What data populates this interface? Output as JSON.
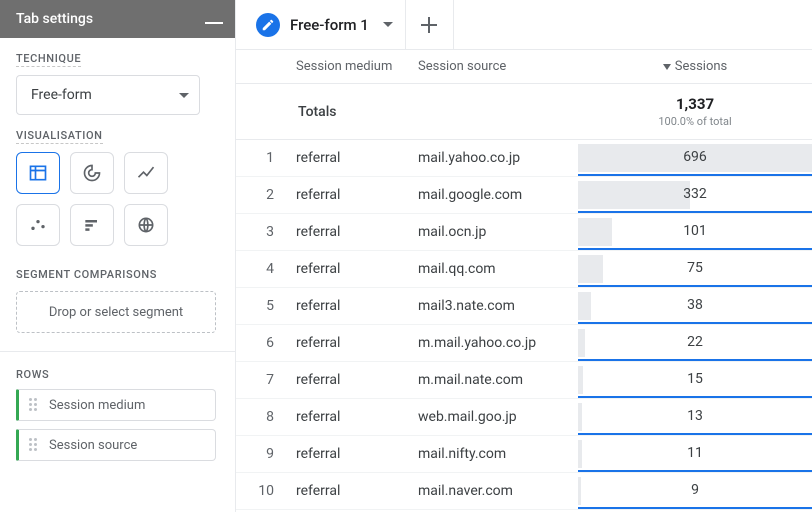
{
  "sidebar": {
    "title": "Tab settings",
    "technique_label": "TECHNIQUE",
    "technique_value": "Free-form",
    "visualisation_label": "VISUALISATION",
    "segment_label": "SEGMENT COMPARISONS",
    "segment_placeholder": "Drop or select segment",
    "rows_label": "ROWS",
    "row_chips": [
      "Session medium",
      "Session source"
    ]
  },
  "tabbar": {
    "tab_title": "Free-form 1"
  },
  "columns": {
    "medium": "Session medium",
    "source": "Session source",
    "sessions": "Sessions"
  },
  "totals": {
    "label": "Totals",
    "value": "1,337",
    "sub": "100.0% of total"
  },
  "chart_data": {
    "type": "bar",
    "title": "Sessions by Session medium / Session source",
    "xlabel": "Session source",
    "ylabel": "Sessions",
    "ylim": [
      0,
      1337
    ],
    "categories": [
      "mail.yahoo.co.jp",
      "mail.google.com",
      "mail.ocn.jp",
      "mail.qq.com",
      "mail3.nate.com",
      "m.mail.yahoo.co.jp",
      "m.mail.nate.com",
      "web.mail.goo.jp",
      "mail.nifty.com",
      "mail.naver.com"
    ],
    "series": [
      {
        "name": "Sessions",
        "values": [
          696,
          332,
          101,
          75,
          38,
          22,
          15,
          13,
          11,
          9
        ]
      }
    ],
    "rows": [
      {
        "idx": "1",
        "medium": "referral",
        "source": "mail.yahoo.co.jp",
        "sessions": 696,
        "label": "696"
      },
      {
        "idx": "2",
        "medium": "referral",
        "source": "mail.google.com",
        "sessions": 332,
        "label": "332"
      },
      {
        "idx": "3",
        "medium": "referral",
        "source": "mail.ocn.jp",
        "sessions": 101,
        "label": "101"
      },
      {
        "idx": "4",
        "medium": "referral",
        "source": "mail.qq.com",
        "sessions": 75,
        "label": "75"
      },
      {
        "idx": "5",
        "medium": "referral",
        "source": "mail3.nate.com",
        "sessions": 38,
        "label": "38"
      },
      {
        "idx": "6",
        "medium": "referral",
        "source": "m.mail.yahoo.co.jp",
        "sessions": 22,
        "label": "22"
      },
      {
        "idx": "7",
        "medium": "referral",
        "source": "m.mail.nate.com",
        "sessions": 15,
        "label": "15"
      },
      {
        "idx": "8",
        "medium": "referral",
        "source": "web.mail.goo.jp",
        "sessions": 13,
        "label": "13"
      },
      {
        "idx": "9",
        "medium": "referral",
        "source": "mail.nifty.com",
        "sessions": 11,
        "label": "11"
      },
      {
        "idx": "10",
        "medium": "referral",
        "source": "mail.naver.com",
        "sessions": 9,
        "label": "9"
      }
    ]
  }
}
